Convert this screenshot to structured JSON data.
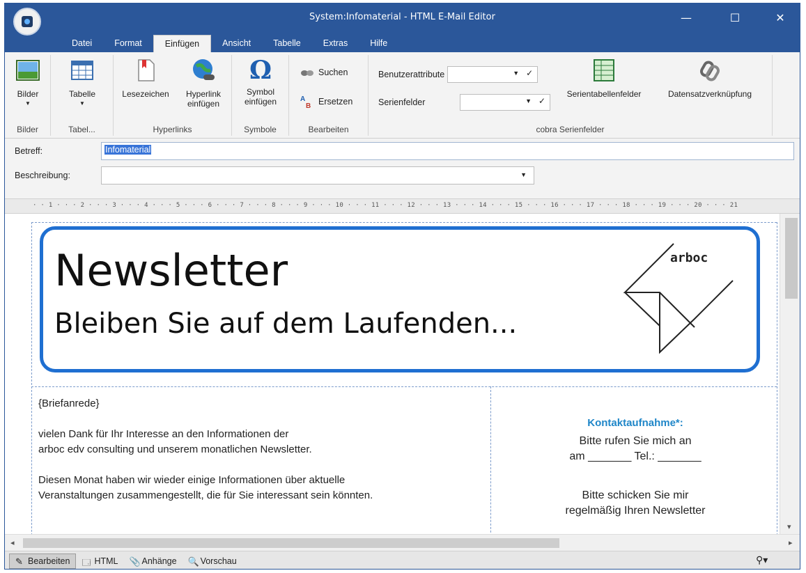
{
  "window": {
    "title": "System:Infomaterial - HTML E-Mail Editor",
    "controls": {
      "minimize": "—",
      "maximize": "☐",
      "close": "✕"
    }
  },
  "menu_tabs": [
    "Datei",
    "Format",
    "Einfügen",
    "Ansicht",
    "Tabelle",
    "Extras",
    "Hilfe"
  ],
  "active_tab": "Einfügen",
  "ribbon": {
    "bilder": {
      "button": "Bilder",
      "group": "Bilder"
    },
    "tabelle": {
      "button": "Tabelle",
      "group": "Tabel..."
    },
    "hyperlinks": {
      "lesezeichen": "Lesezeichen",
      "hyperlink_line1": "Hyperlink",
      "hyperlink_line2": "einfügen",
      "group": "Hyperlinks"
    },
    "symbole": {
      "symbol_line1": "Symbol",
      "symbol_line2": "einfügen",
      "group": "Symbole"
    },
    "bearbeiten": {
      "suchen": "Suchen",
      "ersetzen": "Ersetzen",
      "group": "Bearbeiten"
    },
    "cobra": {
      "benutzerattribute": "Benutzerattribute",
      "serienfelder": "Serienfelder",
      "serientabellenfelder": "Serientabellenfelder",
      "datensatzverknuepfung": "Datensatzverknüpfung",
      "group": "cobra Serienfelder"
    }
  },
  "fields": {
    "betreff_label": "Betreff:",
    "betreff_value": "Infomaterial",
    "beschreibung_label": "Beschreibung:",
    "beschreibung_value": ""
  },
  "ruler": "· · 1 · · · 2 · · · 3 · · · 4 · · · 5 · · · 6 · · · 7 · · · 8 · · · 9 · · · 10 · · · 11 · · · 12 · · · 13 · · · 14 · · · 15 · · · 16 · · · 17 · · · 18 · · · 19 · · · 20 · · · 21",
  "document": {
    "banner_title": "Newsletter",
    "banner_subtitle": "Bleiben Sie auf dem Laufenden...",
    "logo_text": "arboc",
    "salutation": "{Briefanrede}",
    "para1_line1": "vielen Dank für Ihr Interesse an den Informationen der",
    "para1_line2": "arboc edv consulting und unserem monatlichen Newsletter.",
    "para2_line1": "Diesen Monat haben wir wieder einige Informationen über aktuelle",
    "para2_line2": "Veranstaltungen zusammengestellt, die für Sie interessant sein könnten.",
    "kontakt_heading": "Kontaktaufnahme*:",
    "kontakt_line1": "Bitte rufen Sie mich an",
    "kontakt_line2": "am _______ Tel.: _______",
    "kontakt_line3": "Bitte schicken Sie mir",
    "kontakt_line4": "regelmäßig Ihren Newsletter"
  },
  "view_tabs": [
    "Bearbeiten",
    "HTML",
    "Anhänge",
    "Vorschau"
  ],
  "active_view": "Bearbeiten",
  "colors": {
    "titlebar": "#2b579a",
    "banner_border": "#1f6fd1",
    "kontakt": "#1f86c8"
  }
}
